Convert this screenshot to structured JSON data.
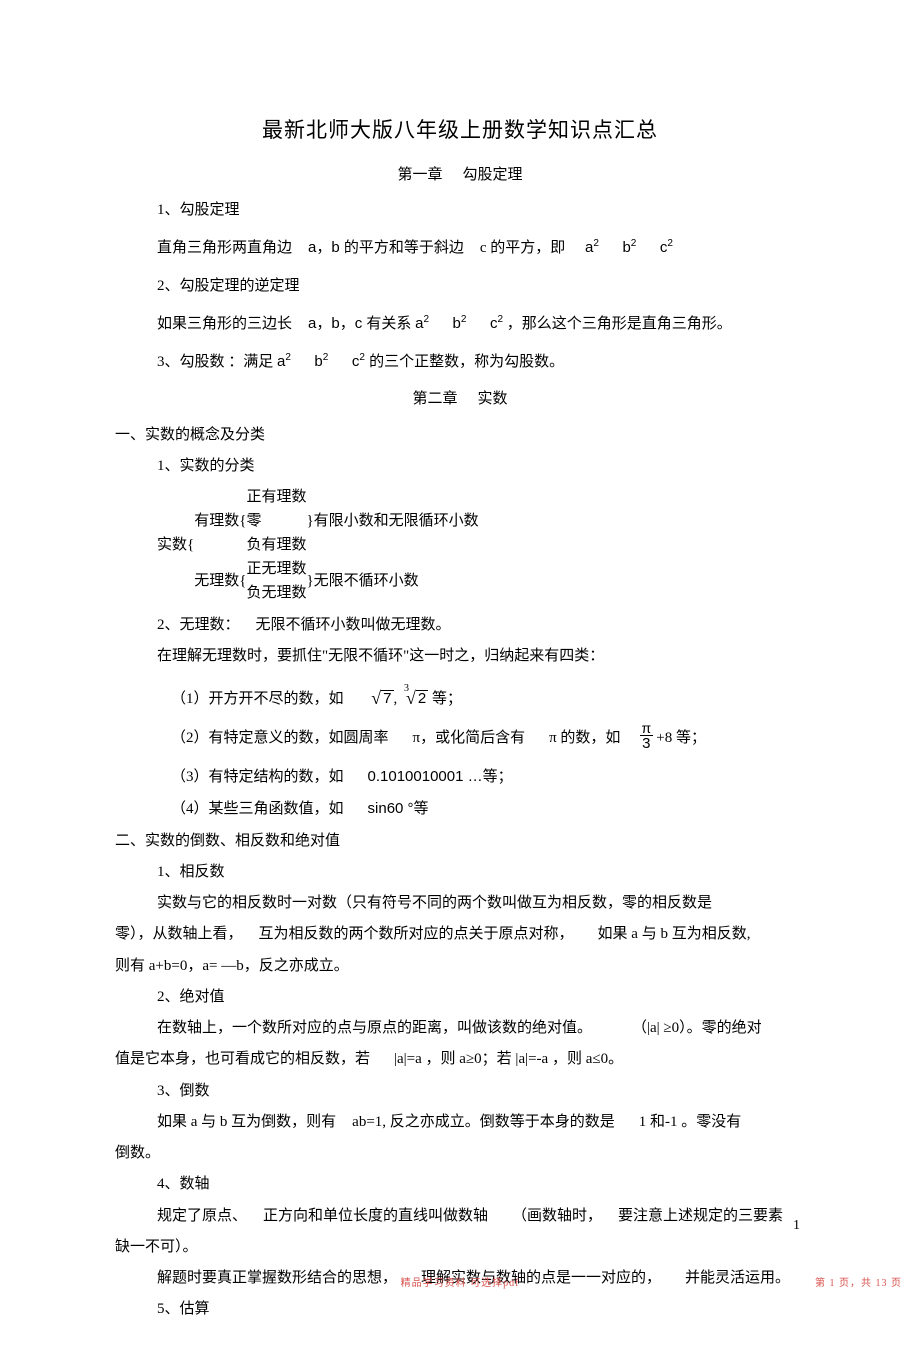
{
  "title": "最新北师大版八年级上册数学知识点汇总",
  "chapter1": {
    "label": "第一章",
    "name": "勾股定理"
  },
  "c1": {
    "h1": "1、勾股定理",
    "p1_a": "直角三角形两直角边",
    "p1_b": "a，b 的平方和等于斜边",
    "p1_c": "c 的平方，即",
    "p1_eq_a": "a",
    "p1_eq_b": "b",
    "p1_eq_c": "c",
    "h2": "2、勾股定理的逆定理",
    "p2_a": "如果三角形的三边长",
    "p2_b": "a，b，c 有关系",
    "p2_c": "，那么这个三角形是直角三角形。",
    "h3_a": "3、勾股数 ：满足",
    "h3_b": "的三个正整数，称为勾股数。"
  },
  "chapter2": {
    "label": "第二章",
    "name": "实数"
  },
  "secA": "一、实数的概念及分类",
  "cA1": "1、实数的分类",
  "tree": {
    "root": "实数",
    "b1": "有理数",
    "b1a": "正有理数",
    "b1b": "零",
    "b1c": "负有理数",
    "b1note": "有限小数和无限循环小数",
    "b2": "无理数",
    "b2a": "正无理数",
    "b2b": "负无理数",
    "b2note": "无限不循环小数"
  },
  "cA2": {
    "h": "2、无理数：",
    "t": "无限不循环小数叫做无理数。",
    "p": "在理解无理数时，要抓住\"无限不循环\"这一时之，归纳起来有四类：",
    "l1_a": "（1）开方开不尽的数，如",
    "l1_c": "等；",
    "sqrt1_rad": "7",
    "sqrt2_idx": "3",
    "sqrt2_rad": "2",
    "l2_a": "（2）有特定意义的数，如圆周率",
    "l2_b": "π，或化简后含有",
    "l2_c": "π 的数，如",
    "l2_d": "+8 等；",
    "frac_num": "π",
    "frac_den": "3",
    "l3_a": "（3）有特定结构的数，如",
    "l3_b": "0.1010010001 …等；",
    "l4_a": "（4）某些三角函数值，如",
    "l4_b": "sin60 °等"
  },
  "secB": "二、实数的倒数、相反数和绝对值",
  "cB": {
    "h1": "1、相反数",
    "p1a": "实数与它的相反数时一对数（只有符号不同的两个数叫做互为相反数，零的相反数是",
    "p1b": "零），从数轴上看，",
    "p1c": "互为相反数的两个数所对应的点关于原点对称，",
    "p1d": "如果 a 与 b 互为相反数,",
    "p1e": "则有 a+b=0，a= —b，反之亦成立。",
    "h2": "2、绝对值",
    "p2a": "在数轴上，一个数所对应的点与原点的距离，叫做该数的绝对值。",
    "p2b": "（|a|  ≥0）。零的绝对",
    "p2c": "值是它本身，也可看成它的相反数，若",
    "p2d": "|a|=a ，则 a≥0；若 |a|=-a ，则 a≤0。",
    "h3": "3、倒数",
    "p3a": "如果 a 与 b 互为倒数，则有",
    "p3b": "ab=1, 反之亦成立。倒数等于本身的数是",
    "p3c": "1 和-1 。零没有",
    "p3d": "倒数。",
    "h4": "4、数轴",
    "p4a": "规定了原点、",
    "p4b": "正方向和单位长度的直线叫做数轴",
    "p4c": "（画数轴时，",
    "p4d": "要注意上述规定的三要素",
    "p4e": "缺一不可）。",
    "p4f": "解题时要真正掌握数形结合的思想，",
    "p4g": "理解实数与数轴的点是一一对应的，",
    "p4h": "并能灵活运用。",
    "h5": "5、估算"
  },
  "pagenum": "1",
  "footer_center": "精品学习资料   可选择pdf",
  "footer_right": "第 1 页，共 13 页"
}
